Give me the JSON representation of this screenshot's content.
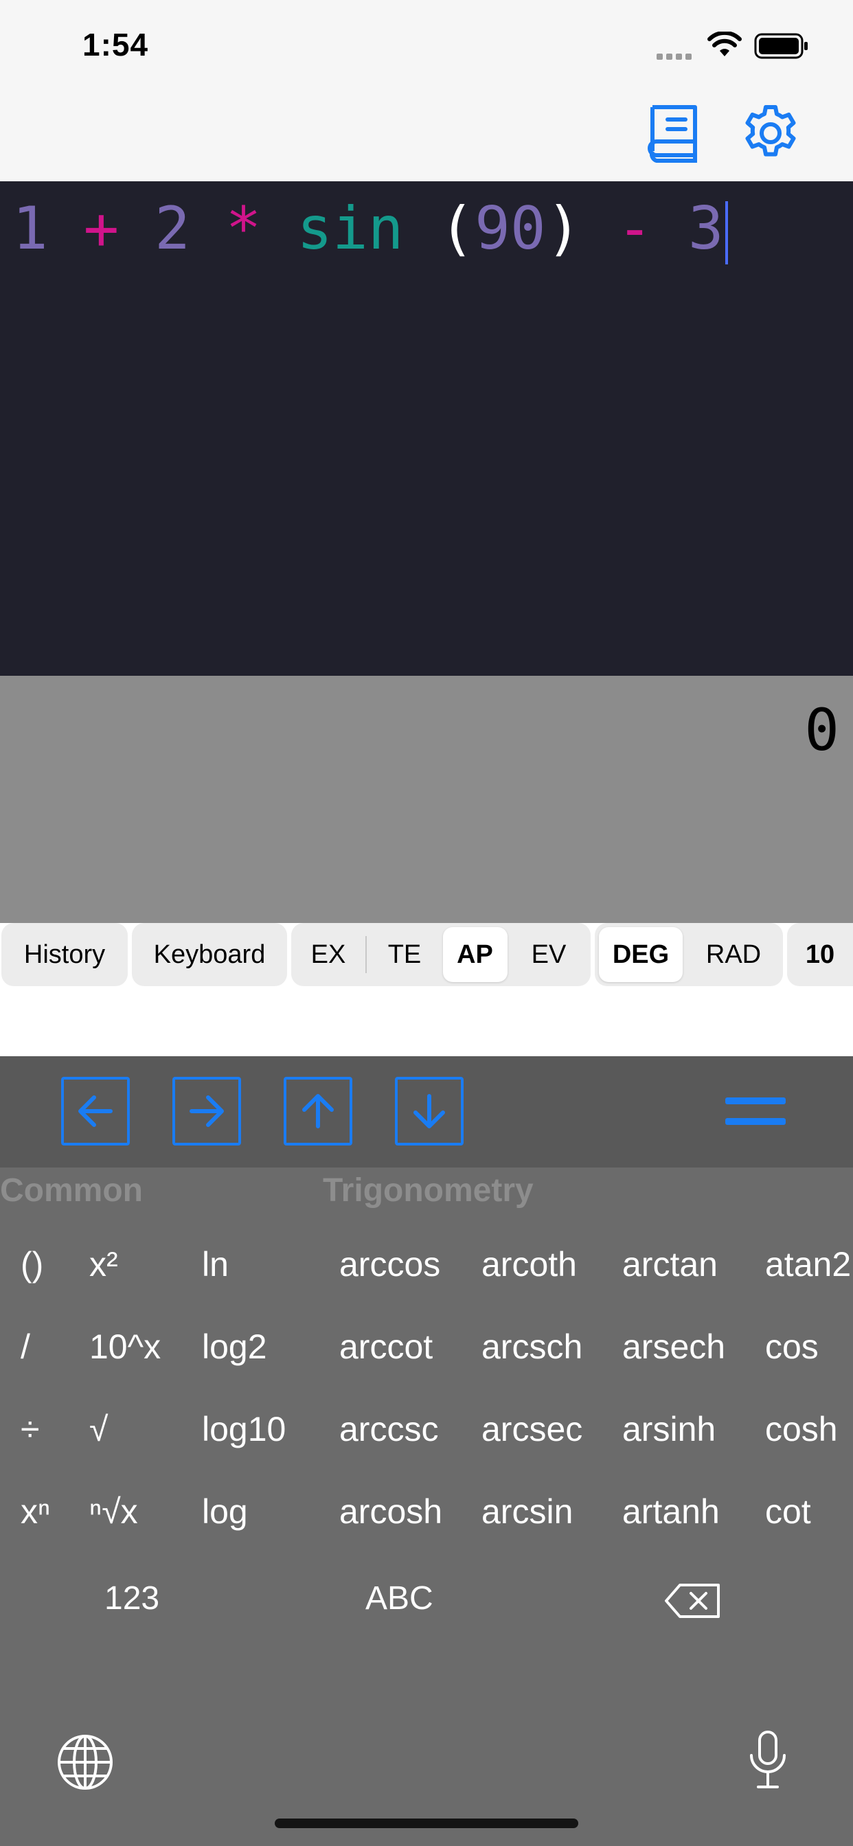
{
  "status": {
    "time": "1:54"
  },
  "nav": {
    "book_icon": "book-icon",
    "settings_icon": "gear-icon"
  },
  "editor": {
    "tokens": [
      {
        "text": "1",
        "kind": "num"
      },
      {
        "text": " + ",
        "kind": "op"
      },
      {
        "text": "2",
        "kind": "num"
      },
      {
        "text": " * ",
        "kind": "op"
      },
      {
        "text": "sin",
        "kind": "fn"
      },
      {
        "text": " (",
        "kind": "par"
      },
      {
        "text": "90",
        "kind": "num"
      },
      {
        "text": ")",
        "kind": "par"
      },
      {
        "text": " - ",
        "kind": "op"
      },
      {
        "text": "3",
        "kind": "num"
      }
    ]
  },
  "result": {
    "value": "0"
  },
  "options": {
    "history": "History",
    "keyboard": "Keyboard",
    "mode": [
      "EX",
      "TE",
      "AP",
      "EV"
    ],
    "mode_selected": "AP",
    "angle": [
      "DEG",
      "RAD"
    ],
    "angle_selected": "DEG",
    "base": "10"
  },
  "keyboard": {
    "common_title": "Common",
    "trig_title": "Trigonometry",
    "common_col1": [
      "()",
      "/",
      "÷",
      "xⁿ"
    ],
    "common_col2": [
      "x²",
      "10^x",
      "√",
      "ⁿ√x"
    ],
    "common_col3": [
      "ln",
      "log2",
      "log10",
      "log"
    ],
    "trig_col1": [
      "arccos",
      "arccot",
      "arccsc",
      "arcosh"
    ],
    "trig_col2": [
      "arcoth",
      "arcsch",
      "arcsec",
      "arcsin"
    ],
    "trig_col3": [
      "arctan",
      "arsech",
      "arsinh",
      "artanh"
    ],
    "trig_col4": [
      "atan2",
      "cos",
      "cosh",
      "cot"
    ],
    "bottom": {
      "numbers": "123",
      "letters": "ABC"
    }
  },
  "colors": {
    "accent": "#1a7cf3",
    "editor_bg": "#20202c",
    "number": "#7a6ab2",
    "operator": "#d0148b",
    "function": "#149a8c"
  }
}
